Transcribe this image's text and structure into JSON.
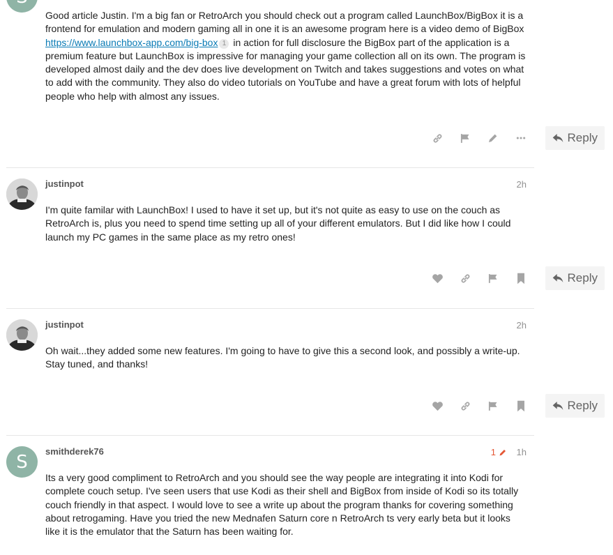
{
  "posts": [
    {
      "avatar_letter": "S",
      "text_before_link": "Good article Justin. I'm a big fan or RetroArch you should check out a program called LaunchBox/BigBox it is a frontend for emulation and modern gaming all in one it is an awesome program here is a video demo of BigBox ",
      "link_text": "https://www.launchbox-app.com/big-box",
      "link_clicks": "1",
      "text_after_link": " in action for full disclosure the BigBox part of the application is a premium feature but LaunchBox is impressive for managing your game collection all on its own. The program is developed almost daily and the dev does live development on Twitch and takes suggestions and votes on what to add with the community. They also do video tutorials on YouTube and have a great forum with lots of helpful people who help with almost any issues.",
      "reply_label": "Reply",
      "icons": [
        "link-icon",
        "flag-icon",
        "pencil-icon",
        "more-icon"
      ]
    },
    {
      "username": "justinpot",
      "date": "2h",
      "text": "I'm quite familar with LaunchBox! I used to have it set up, but it's not quite as easy to use on the couch as RetroArch is, plus you need to spend time setting up all of your different emulators. But I did like how I could launch my PC games in the same place as my retro ones!",
      "reply_label": "Reply",
      "icons": [
        "heart-icon",
        "link-icon",
        "flag-icon",
        "bookmark-icon"
      ]
    },
    {
      "username": "justinpot",
      "date": "2h",
      "text": "Oh wait...they added some new features. I'm going to have to give this a second look, and possibly a write-up. Stay tuned, and thanks!",
      "reply_label": "Reply",
      "icons": [
        "heart-icon",
        "link-icon",
        "flag-icon",
        "bookmark-icon"
      ]
    },
    {
      "avatar_letter": "S",
      "username": "smithderek76",
      "edit_count": "1",
      "date": "1h",
      "text": "Its a very good compliment to RetroArch and you should see the way people are integrating it into Kodi for complete couch setup. I've seen users that use Kodi as their shell and BigBox from inside of Kodi so its totally couch friendly in that aspect. I would love to see a write up about the program thanks for covering something about retrogaming. Have you tried the new Mednafen Saturn core n RetroArch ts very early beta but it looks like it is the emulator that the Saturn has been waiting for."
    }
  ],
  "colors": {
    "avatar_bg": "#8fb4a6",
    "link": "#0a7bb5",
    "edit_orange": "#e45735",
    "icon_gray": "#a5a5a5",
    "reply_bg": "#f4f4f4"
  }
}
